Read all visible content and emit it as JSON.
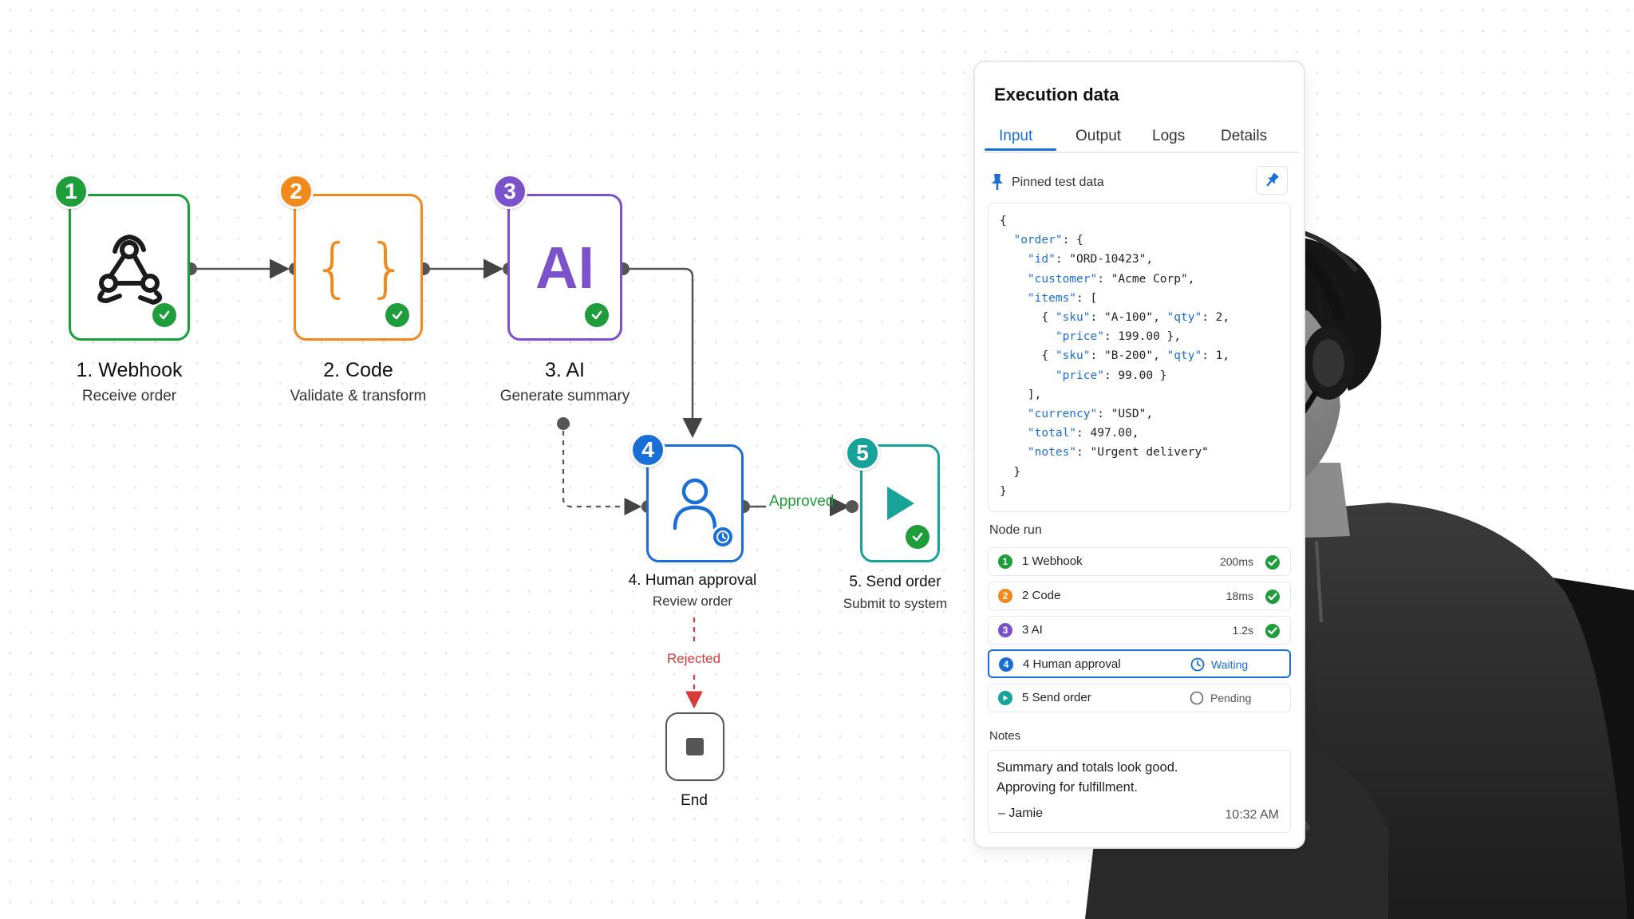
{
  "nodes": [
    {
      "num": "1",
      "title": "1. Webhook",
      "subtitle": "Receive order",
      "color": "#1f9d3a",
      "icon": "webhook-icon"
    },
    {
      "num": "2",
      "title": "2. Code",
      "subtitle": "Validate & transform",
      "color": "#f08a1c",
      "icon_text": "{ }"
    },
    {
      "num": "3",
      "title": "3. AI",
      "subtitle": "Generate summary",
      "color": "#7b52c9",
      "icon_text": "AI"
    },
    {
      "num": "4",
      "title": "4. Human approval",
      "subtitle": "Review order",
      "color": "#1a6fd6",
      "icon": "user-icon"
    },
    {
      "num": "5",
      "title": "5. Send order",
      "subtitle": "Submit to system",
      "color": "#17a39a",
      "icon": "play-icon"
    }
  ],
  "end_node": {
    "title": "End",
    "icon": "stop-icon"
  },
  "edges": {
    "approved": "Approved",
    "rejected": "Rejected"
  },
  "colors": {
    "accent": "#1a6fd6",
    "success": "#1f9d3a",
    "rejected": "#d93b3b",
    "approved": "#1f9d3a"
  },
  "panel": {
    "title": "Execution data",
    "tabs": [
      "Input",
      "Output",
      "Logs",
      "Details"
    ],
    "active_tab": "Input",
    "pinned_label": "Pinned test data",
    "code_lines": [
      "{",
      "  \"order\": {",
      "    \"id\": \"ORD-10423\",",
      "    \"customer\": \"Acme Corp\",",
      "    \"items\": [",
      "      { \"sku\": \"A-100\", \"qty\": 2,",
      "        \"price\": 199.00 },",
      "      { \"sku\": \"B-200\", \"qty\": 1,",
      "        \"price\": 99.00 }",
      "    ],",
      "    \"currency\": \"USD\",",
      "    \"total\": 497.00,",
      "    \"notes\": \"Urgent delivery\"",
      "  }",
      "}"
    ],
    "node_run_label": "Node run",
    "runs": [
      {
        "num": "1",
        "name": "1 Webhook",
        "time": "200ms",
        "status": "done",
        "color": "#1f9d3a"
      },
      {
        "num": "2",
        "name": "2 Code",
        "time": "18ms",
        "status": "done",
        "color": "#f08a1c"
      },
      {
        "num": "3",
        "name": "3 AI",
        "time": "1.2s",
        "status": "done",
        "color": "#7b52c9"
      },
      {
        "num": "4",
        "name": "4 Human approval",
        "status_text": "Waiting",
        "status": "waiting",
        "color": "#1a6fd6"
      },
      {
        "num": "5",
        "name": "5 Send order",
        "status_text": "Pending",
        "status": "pending",
        "color": "#17a39a"
      }
    ],
    "notes_label": "Notes",
    "notes": {
      "line1": "Summary and totals look good.",
      "line2": "Approving for fulfillment.",
      "author": "– Jamie",
      "time": "10:32 AM"
    }
  }
}
